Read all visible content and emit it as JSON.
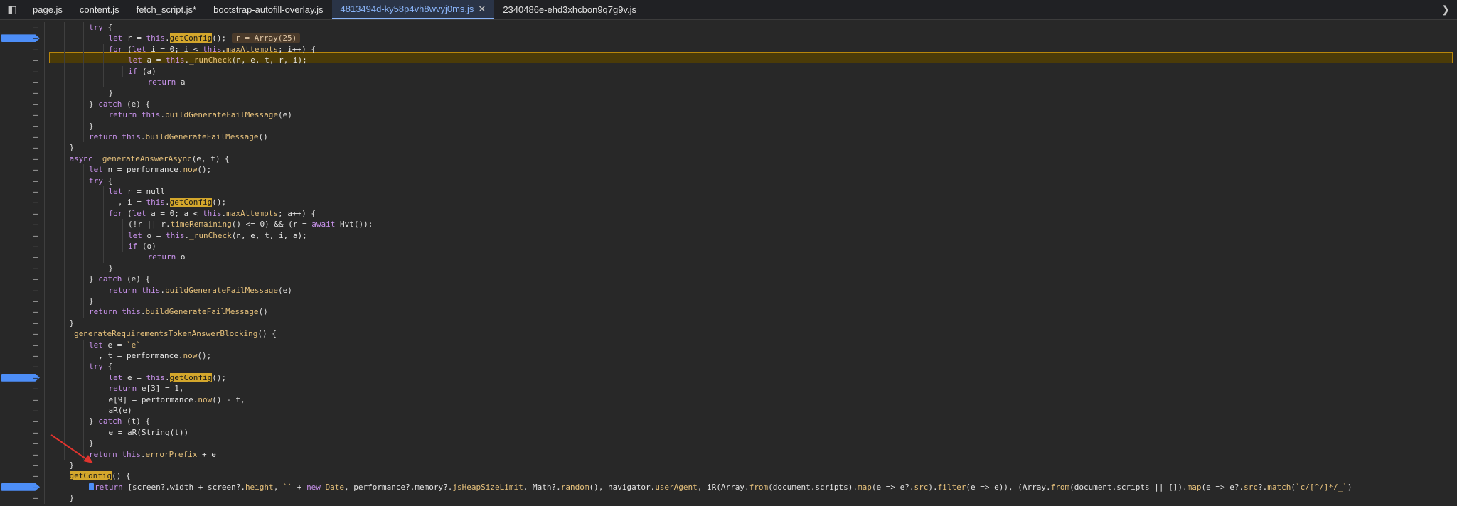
{
  "tabs": [
    {
      "label": "page.js",
      "active": false
    },
    {
      "label": "content.js",
      "active": false
    },
    {
      "label": "fetch_script.js*",
      "active": false
    },
    {
      "label": "bootstrap-autofill-overlay.js",
      "active": false
    },
    {
      "label": "4813494d-ky58p4vh8wvyj0ms.js",
      "active": true
    },
    {
      "label": "2340486e-ehd3xhcbon9q7g9v.js",
      "active": false
    }
  ],
  "icons": {
    "sidebar_toggle": "panel-toggle-icon",
    "tab_close": "close-icon",
    "more_tabs": "chevron-right-icon"
  },
  "colors": {
    "breakpoint": "#4d8ef7",
    "paused_line": "#4b3b08",
    "active_tab": "#8ab4f8",
    "annotation_arrow": "#e0342e"
  },
  "inline_value": "r = Array(25)",
  "code_lines": [
    {
      "text": "try {",
      "indent": 3,
      "bp": false
    },
    {
      "text": "let r = this.getConfig();",
      "indent": 4,
      "bp": true
    },
    {
      "text": "for (let i = 0; i < this.maxAttempts; i++) {",
      "indent": 4,
      "bp": false,
      "paused": true
    },
    {
      "text": "let a = this._runCheck(n, e, t, r, i);",
      "indent": 5,
      "bp": false
    },
    {
      "text": "if (a)",
      "indent": 5,
      "bp": false
    },
    {
      "text": "return a",
      "indent": 6,
      "bp": false
    },
    {
      "text": "}",
      "indent": 4,
      "bp": false
    },
    {
      "text": "} catch (e) {",
      "indent": 3,
      "bp": false
    },
    {
      "text": "return this.buildGenerateFailMessage(e)",
      "indent": 4,
      "bp": false
    },
    {
      "text": "}",
      "indent": 3,
      "bp": false
    },
    {
      "text": "return this.buildGenerateFailMessage()",
      "indent": 3,
      "bp": false
    },
    {
      "text": "}",
      "indent": 2,
      "bp": false
    },
    {
      "text": "async _generateAnswerAsync(e, t) {",
      "indent": 2,
      "bp": false
    },
    {
      "text": "let n = performance.now();",
      "indent": 3,
      "bp": false
    },
    {
      "text": "try {",
      "indent": 3,
      "bp": false
    },
    {
      "text": "let r = null",
      "indent": 4,
      "bp": false
    },
    {
      "text": "  , i = this.getConfig();",
      "indent": 4,
      "bp": false
    },
    {
      "text": "for (let a = 0; a < this.maxAttempts; a++) {",
      "indent": 4,
      "bp": false
    },
    {
      "text": "(!r || r.timeRemaining() <= 0) && (r = await Hvt());",
      "indent": 5,
      "bp": false
    },
    {
      "text": "let o = this._runCheck(n, e, t, i, a);",
      "indent": 5,
      "bp": false
    },
    {
      "text": "if (o)",
      "indent": 5,
      "bp": false
    },
    {
      "text": "return o",
      "indent": 6,
      "bp": false
    },
    {
      "text": "}",
      "indent": 4,
      "bp": false
    },
    {
      "text": "} catch (e) {",
      "indent": 3,
      "bp": false
    },
    {
      "text": "return this.buildGenerateFailMessage(e)",
      "indent": 4,
      "bp": false
    },
    {
      "text": "}",
      "indent": 3,
      "bp": false
    },
    {
      "text": "return this.buildGenerateFailMessage()",
      "indent": 3,
      "bp": false
    },
    {
      "text": "}",
      "indent": 2,
      "bp": false
    },
    {
      "text": "_generateRequirementsTokenAnswerBlocking() {",
      "indent": 2,
      "bp": false
    },
    {
      "text": "let e = `e`",
      "indent": 3,
      "bp": false
    },
    {
      "text": "  , t = performance.now();",
      "indent": 3,
      "bp": false
    },
    {
      "text": "try {",
      "indent": 3,
      "bp": false
    },
    {
      "text": "let e = this.getConfig();",
      "indent": 4,
      "bp": true
    },
    {
      "text": "return e[3] = 1,",
      "indent": 4,
      "bp": false
    },
    {
      "text": "e[9] = performance.now() - t,",
      "indent": 4,
      "bp": false
    },
    {
      "text": "aR(e)",
      "indent": 4,
      "bp": false
    },
    {
      "text": "} catch (t) {",
      "indent": 3,
      "bp": false
    },
    {
      "text": "e = aR(String(t))",
      "indent": 4,
      "bp": false
    },
    {
      "text": "}",
      "indent": 3,
      "bp": false
    },
    {
      "text": "return this.errorPrefix + e",
      "indent": 3,
      "bp": false
    },
    {
      "text": "}",
      "indent": 2,
      "bp": false
    },
    {
      "text": "getConfig() {",
      "indent": 2,
      "bp": false
    },
    {
      "text": "return [screen?.width + screen?.height, `` + new Date, performance?.memory?.jsHeapSizeLimit, Math?.random(), navigator.userAgent, iR(Array.from(document.scripts).map(e => e?.src).filter(e => e)), (Array.from(document.scripts || []).map(e => e?.src?.match(`c/[^/]*/_`)",
      "indent": 3,
      "bp": true
    },
    {
      "text": "}",
      "indent": 2,
      "bp": false
    },
    {
      "text": "}",
      "indent": 1,
      "bp": false
    }
  ]
}
